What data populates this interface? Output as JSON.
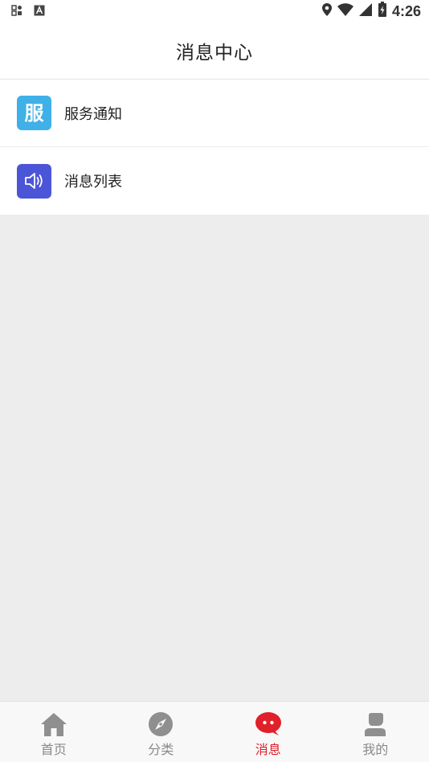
{
  "status_bar": {
    "time": "4:26",
    "left_icons": [
      "sim-card-icon",
      "font-a-icon"
    ],
    "right_icons": [
      "location-icon",
      "wifi-icon",
      "signal-icon",
      "battery-charging-icon"
    ]
  },
  "header": {
    "title": "消息中心"
  },
  "list": {
    "items": [
      {
        "label": "服务通知",
        "icon_text": "服",
        "icon": "service-icon",
        "color": "#3fb0e8"
      },
      {
        "label": "消息列表",
        "icon": "speaker-icon",
        "color": "#4b55d8"
      }
    ]
  },
  "tab_bar": {
    "active_color": "#e0202a",
    "inactive_color": "#8a8a8a",
    "tabs": [
      {
        "label": "首页",
        "icon": "home-icon"
      },
      {
        "label": "分类",
        "icon": "compass-icon"
      },
      {
        "label": "消息",
        "icon": "chat-bubble-icon",
        "active": true
      },
      {
        "label": "我的",
        "icon": "user-icon"
      }
    ]
  }
}
